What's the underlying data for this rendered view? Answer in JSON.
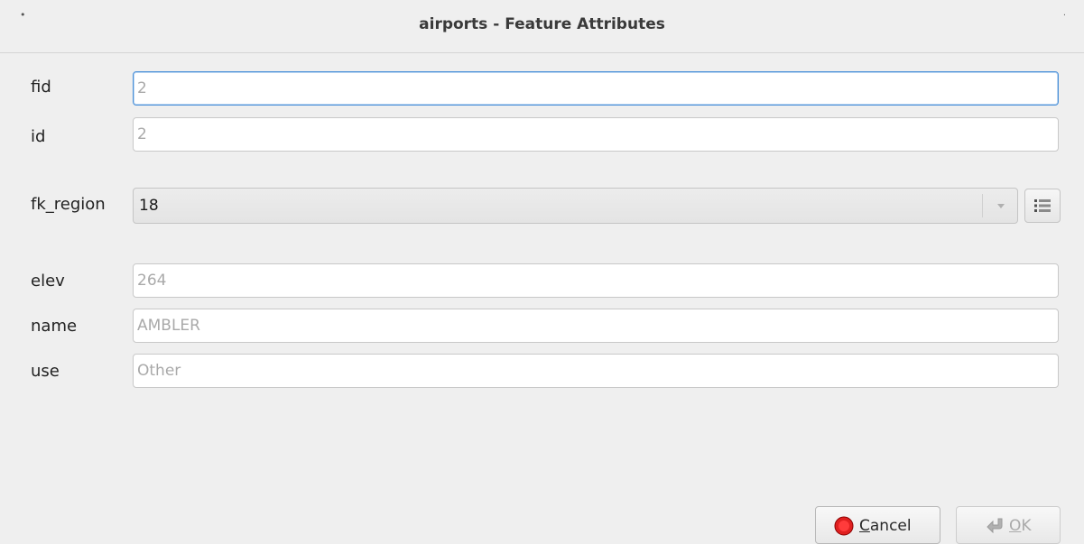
{
  "window": {
    "title": "airports - Feature Attributes",
    "menu_glyph": "•",
    "close_glyph": "·"
  },
  "fields": {
    "fid": {
      "label": "fid",
      "value": "2"
    },
    "id": {
      "label": "id",
      "value": "2"
    },
    "fk_region": {
      "label": "fk_region",
      "value": "18"
    },
    "elev": {
      "label": "elev",
      "value": "264"
    },
    "name": {
      "label": "name",
      "value": "AMBLER"
    },
    "use": {
      "label": "use",
      "value": "Other"
    }
  },
  "buttons": {
    "cancel": {
      "mnemonic": "C",
      "rest": "ancel",
      "icon": "stop-icon"
    },
    "ok": {
      "mnemonic": "O",
      "rest": "K",
      "icon": "ok-arrow-icon",
      "enabled": false
    }
  },
  "icons": {
    "form_button": "open-form-icon",
    "dropdown": "chevron-down-icon"
  },
  "colors": {
    "focus": "#4a90d9",
    "stop_red": "#e02020",
    "disabled_text": "#aaaaaa",
    "placeholder_text": "#a9a9a9"
  }
}
